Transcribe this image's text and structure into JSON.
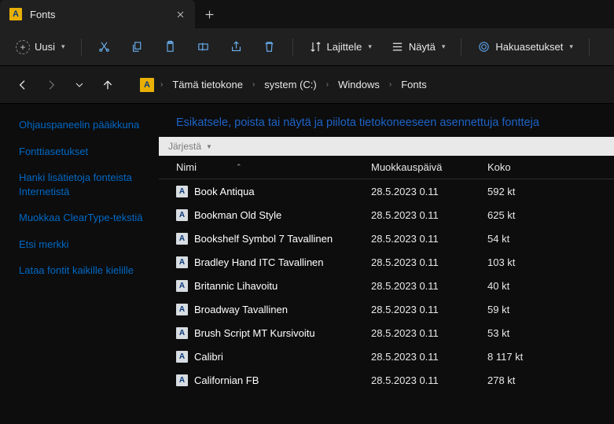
{
  "tab": {
    "title": "Fonts"
  },
  "toolbar": {
    "new_label": "Uusi",
    "sort_label": "Lajittele",
    "view_label": "Näytä",
    "search_label": "Hakuasetukset"
  },
  "breadcrumb": {
    "items": [
      "Tämä tietokone",
      "system (C:)",
      "Windows",
      "Fonts"
    ]
  },
  "sidebar": {
    "items": [
      "Ohjauspaneelin pääikkuna",
      "Fonttiasetukset",
      "Hanki lisätietoja fonteista Internetistä",
      "Muokkaa ClearType-tekstiä",
      "Etsi merkki",
      "Lataa fontit kaikille kielille"
    ]
  },
  "main": {
    "header": "Esikatsele, poista tai näytä ja piilota tietokoneeseen asennettuja fontteja",
    "sort": "Järjestä",
    "columns": {
      "name": "Nimi",
      "modified": "Muokkauspäivä",
      "size": "Koko"
    }
  },
  "fonts": [
    {
      "name": "Book Antiqua",
      "modified": "28.5.2023 0.11",
      "size": "592 kt"
    },
    {
      "name": "Bookman Old Style",
      "modified": "28.5.2023 0.11",
      "size": "625 kt"
    },
    {
      "name": "Bookshelf Symbol 7 Tavallinen",
      "modified": "28.5.2023 0.11",
      "size": "54 kt"
    },
    {
      "name": "Bradley Hand ITC Tavallinen",
      "modified": "28.5.2023 0.11",
      "size": "103 kt"
    },
    {
      "name": "Britannic Lihavoitu",
      "modified": "28.5.2023 0.11",
      "size": "40 kt"
    },
    {
      "name": "Broadway Tavallinen",
      "modified": "28.5.2023 0.11",
      "size": "59 kt"
    },
    {
      "name": "Brush Script MT Kursivoitu",
      "modified": "28.5.2023 0.11",
      "size": "53 kt"
    },
    {
      "name": "Calibri",
      "modified": "28.5.2023 0.11",
      "size": "8 117 kt"
    },
    {
      "name": "Californian FB",
      "modified": "28.5.2023 0.11",
      "size": "278 kt"
    }
  ]
}
